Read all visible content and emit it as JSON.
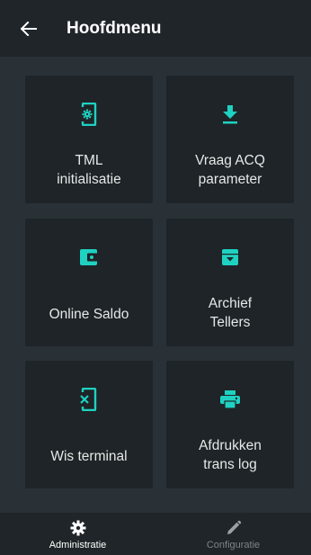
{
  "header": {
    "title": "Hoofdmenu",
    "back_icon": "arrow-left-icon"
  },
  "colors": {
    "accent": "#1fd1c1",
    "header_bg": "#1f2528",
    "screen_bg": "#2a3136",
    "tile_bg": "#1e2427",
    "text": "#e6e8e9",
    "nav_inactive": "#7d8488"
  },
  "tiles": [
    {
      "label": "TML\ninitialisatie",
      "icon": "phone-settings-icon"
    },
    {
      "label": "Vraag ACQ\nparameter",
      "icon": "download-icon"
    },
    {
      "label": "Online Saldo",
      "icon": "wallet-icon"
    },
    {
      "label": "Archief\nTellers",
      "icon": "archive-icon"
    },
    {
      "label": "Wis terminal",
      "icon": "phone-erase-icon"
    },
    {
      "label": "Afdrukken\ntrans log",
      "icon": "printer-icon"
    }
  ],
  "bottom_nav": {
    "items": [
      {
        "label": "Administratie",
        "icon": "gear-icon",
        "active": true
      },
      {
        "label": "Configuratie",
        "icon": "pencil-icon",
        "active": false
      }
    ]
  }
}
